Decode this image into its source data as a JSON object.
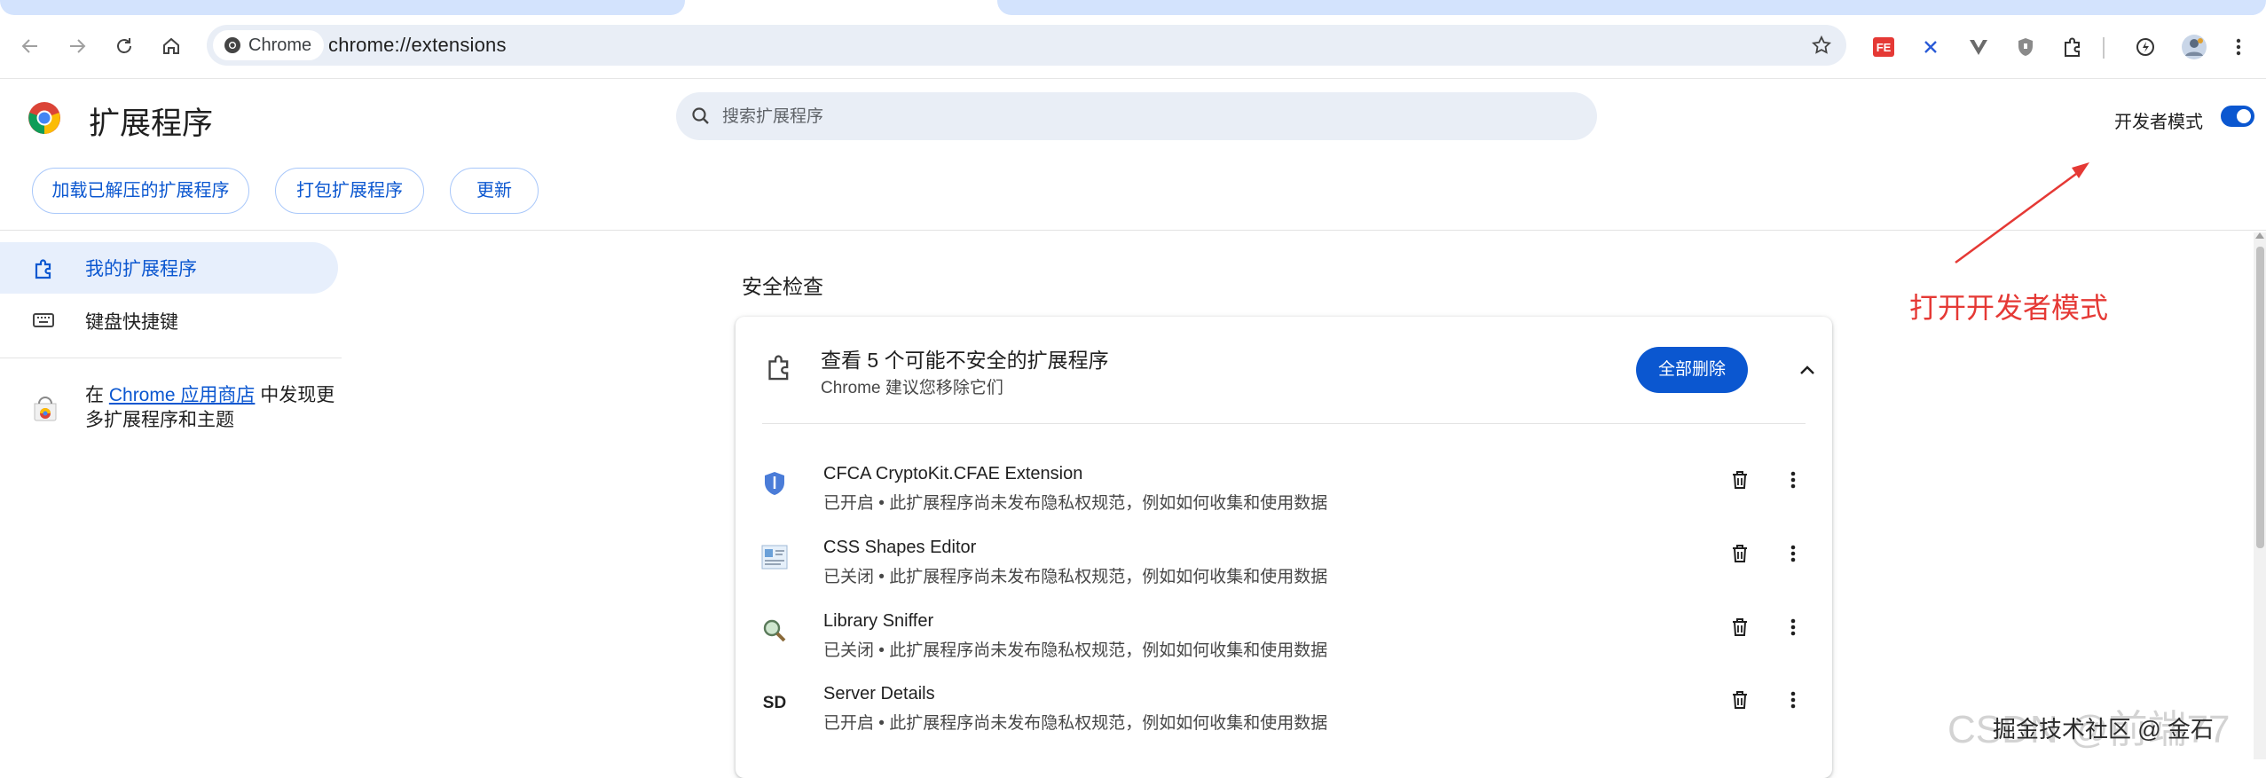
{
  "browser": {
    "chip_label": "Chrome",
    "url": "chrome://extensions"
  },
  "header": {
    "title": "扩展程序",
    "search_placeholder": "搜索扩展程序",
    "dev_mode_label": "开发者模式",
    "dev_mode_on": true,
    "buttons": {
      "load_unpacked": "加载已解压的扩展程序",
      "pack": "打包扩展程序",
      "update": "更新"
    }
  },
  "sidebar": {
    "items": [
      {
        "label": "我的扩展程序",
        "icon": "extension-puzzle-icon"
      },
      {
        "label": "键盘快捷键",
        "icon": "keyboard-icon"
      }
    ],
    "store_prefix": "在 ",
    "store_link": "Chrome 应用商店",
    "store_suffix": " 中发现更多扩展程序和主题"
  },
  "safety": {
    "section_title": "安全检查",
    "card_title": "查看 5 个可能不安全的扩展程序",
    "card_subtitle": "Chrome 建议您移除它们",
    "remove_all": "全部删除",
    "extensions": [
      {
        "name": "CFCA CryptoKit.CFAE Extension",
        "desc": "已开启 • 此扩展程序尚未发布隐私权规范，例如如何收集和使用数据",
        "icon": "shield-icon"
      },
      {
        "name": "CSS Shapes Editor",
        "desc": "已关闭 • 此扩展程序尚未发布隐私权规范，例如如何收集和使用数据",
        "icon": "css-editor-icon"
      },
      {
        "name": "Library Sniffer",
        "desc": "已关闭 • 此扩展程序尚未发布隐私权规范，例如如何收集和使用数据",
        "icon": "magnifier-icon"
      },
      {
        "name": "Server Details",
        "desc": "已开启 • 此扩展程序尚未发布隐私权规范，例如如何收集和使用数据",
        "icon": "sd-text-icon",
        "icon_text": "SD"
      }
    ]
  },
  "annotation": {
    "text": "打开开发者模式",
    "color": "#e53935"
  },
  "watermark": {
    "large": "CSDN @前端77",
    "small": "掘金技术社区 @ 金石"
  },
  "colors": {
    "accent": "#0b57d0",
    "selected_bg": "#e7effc",
    "omnibox_bg": "#e9eef6"
  }
}
